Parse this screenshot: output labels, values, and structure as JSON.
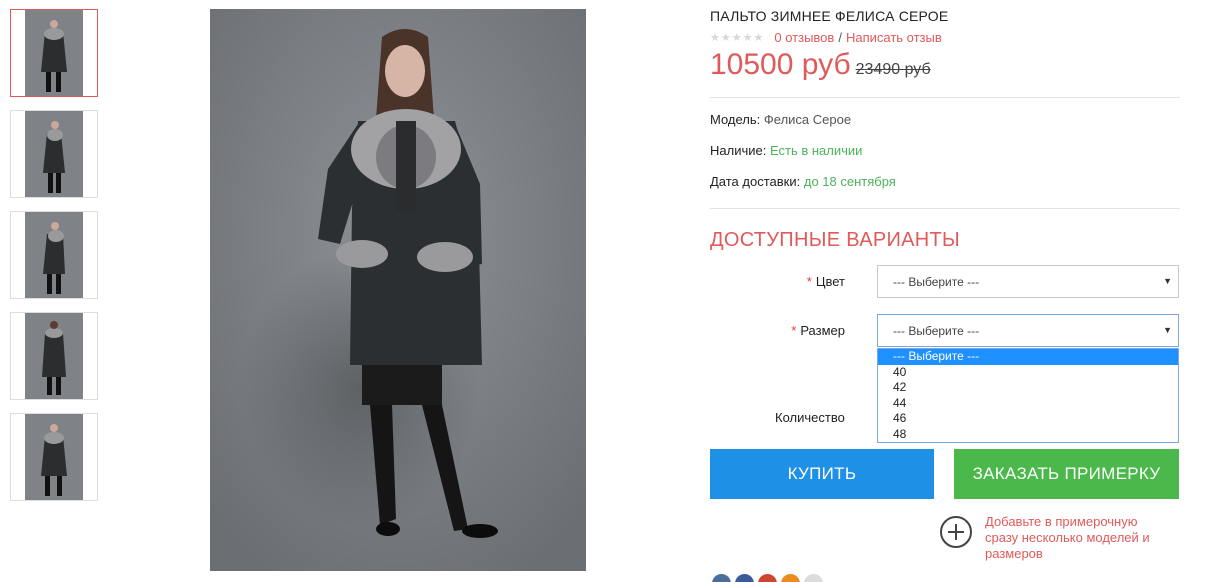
{
  "product": {
    "title": "ПАЛЬТО ЗИМНЕЕ ФЕЛИСА СЕРОЕ",
    "reviews_link": "0 отзывов",
    "separator": "/",
    "write_review_link": "Написать отзыв",
    "rating": 0,
    "price_new": "10500 руб",
    "price_old": "23490 руб"
  },
  "meta": {
    "model_label": "Модель:",
    "model_value": "Фелиса Серое",
    "stock_label": "Наличие:",
    "stock_value": "Есть в наличии",
    "delivery_label": "Дата доставки:",
    "delivery_value": "до 18 сентября"
  },
  "options": {
    "title": "ДОСТУПНЫЕ ВАРИАНТЫ",
    "required_mark": "*",
    "color_label": "Цвет",
    "color_value": "--- Выберите ---",
    "size_label": "Размер",
    "size_value": "--- Выберите ---",
    "size_options": [
      "--- Выберите ---",
      "40",
      "42",
      "44",
      "46",
      "48"
    ],
    "quantity_label": "Количество"
  },
  "buttons": {
    "buy": "КУПИТЬ",
    "fitting": "ЗАКАЗАТЬ ПРИМЕРКУ"
  },
  "fitting_note": {
    "line1": "Добавьте в примерочную",
    "line2": "сразу несколько моделей и",
    "line3": "размеров"
  },
  "colors": {
    "accent_red": "#e05a5a",
    "buy_blue": "#1e90e6",
    "fit_green": "#4ab84a",
    "stock_green": "#4cb35a"
  },
  "icons": {
    "plus": "plus-circle-icon",
    "social": [
      "vk-icon",
      "facebook-icon",
      "google-plus-icon",
      "odnoklassniki-icon",
      "share-icon"
    ]
  },
  "thumbnails": [
    "front-pose",
    "side-pose",
    "side-pose-2",
    "back-pose",
    "front-pose-2"
  ]
}
